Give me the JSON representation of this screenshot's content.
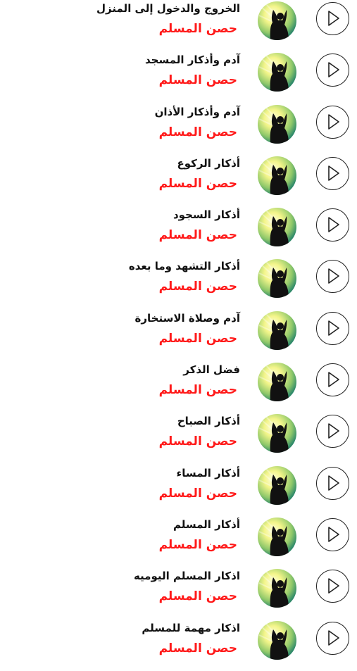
{
  "items": [
    {
      "title": "الخروج والدخول إلى المنزل",
      "subtitle": "حصن المسلم"
    },
    {
      "title": "آدم وأذكار المسجد",
      "subtitle": "حصن المسلم"
    },
    {
      "title": "آدم وأذكار الأذان",
      "subtitle": "حصن المسلم"
    },
    {
      "title": "أذكار الركوع",
      "subtitle": "حصن المسلم"
    },
    {
      "title": "أذكار السجود",
      "subtitle": "حصن المسلم"
    },
    {
      "title": "أذكار التشهد وما بعده",
      "subtitle": "حصن المسلم"
    },
    {
      "title": "آدم وصلاة الاستخارة",
      "subtitle": "حصن المسلم"
    },
    {
      "title": "فضل الذكر",
      "subtitle": "حصن المسلم"
    },
    {
      "title": "أذكار الصباح",
      "subtitle": "حصن المسلم"
    },
    {
      "title": "أذكار المساء",
      "subtitle": "حصن المسلم"
    },
    {
      "title": "أذكار المسلم",
      "subtitle": "حصن المسلم"
    },
    {
      "title": "اذكار المسلم اليوميه",
      "subtitle": "حصن المسلم"
    },
    {
      "title": "اذكار مهمة للمسلم",
      "subtitle": "حصن المسلم"
    }
  ],
  "icons": {
    "avatar": "praying-person-silhouette",
    "play": "play-icon"
  },
  "colors": {
    "title": "#111111",
    "subtitle": "#ff1a1a",
    "play_border": "#222222",
    "avatar_glow": "#f3f58a",
    "avatar_outer": "#2f8a6a"
  }
}
